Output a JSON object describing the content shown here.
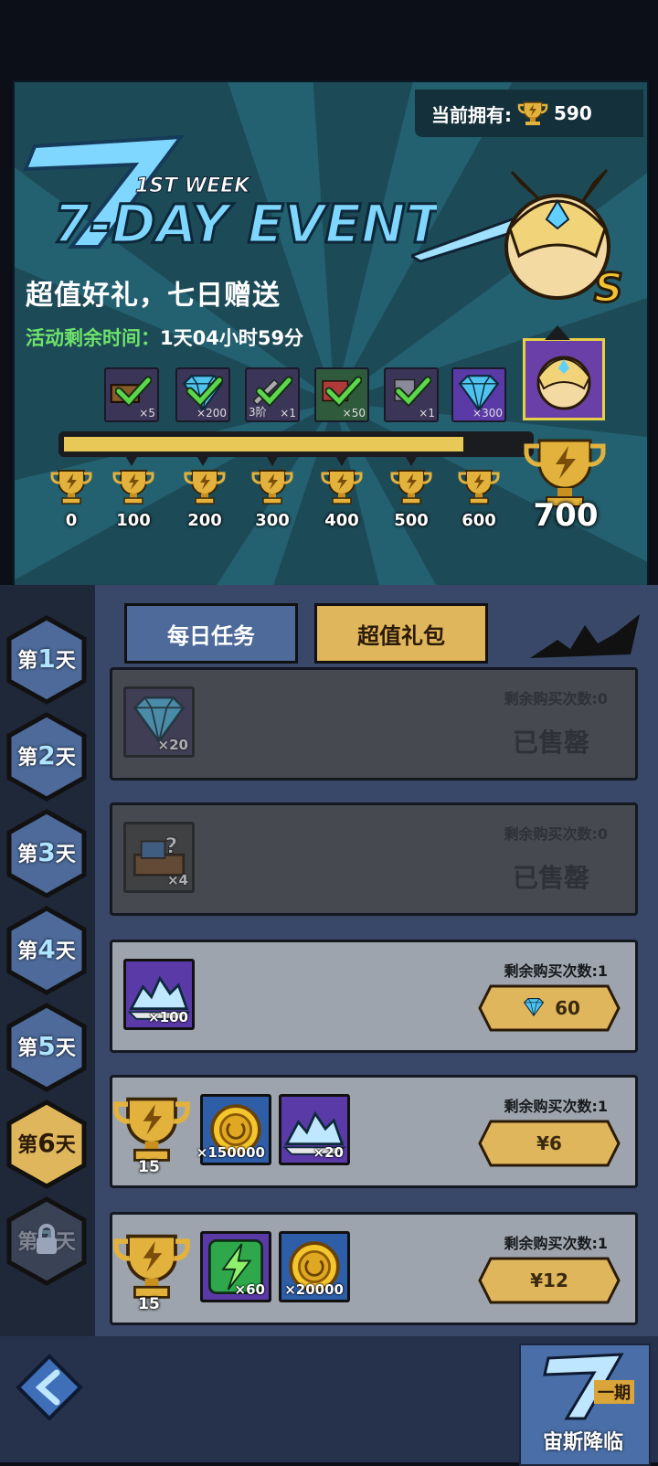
{
  "header": {
    "owned_label": "当前拥有:",
    "owned_value": "590",
    "event_week": "1ST WEEK",
    "event_name": "7-DAY EVENT",
    "subtitle": "超值好礼，七日赠送",
    "timer_label": "活动剩余时间：",
    "timer_value": "1天04小时59分",
    "hero_rank": "S"
  },
  "rewards": [
    {
      "qty": "×5",
      "claimed": true,
      "kind": "chest"
    },
    {
      "qty": "×200",
      "claimed": true,
      "kind": "diamond"
    },
    {
      "qty": "×1",
      "prefix": "3阶",
      "claimed": true,
      "kind": "weapon"
    },
    {
      "qty": "×50",
      "claimed": true,
      "kind": "book"
    },
    {
      "qty": "×1",
      "claimed": true,
      "kind": "gear"
    },
    {
      "qty": "×300",
      "claimed": false,
      "kind": "diamond"
    }
  ],
  "milestones": [
    "0",
    "100",
    "200",
    "300",
    "400",
    "500",
    "600"
  ],
  "final_milestone": "700",
  "progress_fraction": 0.86,
  "days": [
    {
      "prefix": "第",
      "num": "1",
      "suffix": "天",
      "state": "normal"
    },
    {
      "prefix": "第",
      "num": "2",
      "suffix": "天",
      "state": "normal"
    },
    {
      "prefix": "第",
      "num": "3",
      "suffix": "天",
      "state": "normal"
    },
    {
      "prefix": "第",
      "num": "4",
      "suffix": "天",
      "state": "normal"
    },
    {
      "prefix": "第",
      "num": "5",
      "suffix": "天",
      "state": "normal"
    },
    {
      "prefix": "第",
      "num": "6",
      "suffix": "天",
      "state": "active"
    },
    {
      "prefix": "第",
      "num": "7",
      "suffix": "天",
      "state": "locked"
    }
  ],
  "tabs": {
    "daily": "每日任务",
    "pack": "超值礼包"
  },
  "packs": [
    {
      "remain": "剩余购买次数:0",
      "status": "已售罄",
      "items": [
        {
          "kind": "diamond",
          "qty": "×20"
        }
      ]
    },
    {
      "remain": "剩余购买次数:0",
      "status": "已售罄",
      "items": [
        {
          "kind": "mystery-chest",
          "qty": "×4"
        }
      ]
    },
    {
      "remain": "剩余购买次数:1",
      "price": "60",
      "items": [
        {
          "kind": "diamond-pile",
          "qty": "×100"
        }
      ]
    },
    {
      "remain": "剩余购买次数:1",
      "price": "¥6",
      "cup": "15",
      "items": [
        {
          "kind": "gold-coin",
          "qty": "×150000"
        },
        {
          "kind": "diamond-pile",
          "qty": "×20"
        }
      ]
    },
    {
      "remain": "剩余购买次数:1",
      "price": "¥12",
      "cup": "15",
      "items": [
        {
          "kind": "energy",
          "qty": "×60"
        },
        {
          "kind": "gold-coin",
          "qty": "×20000"
        }
      ]
    }
  ],
  "bottom": {
    "zeus_label": "宙斯降临",
    "zeus_badge": "一期"
  },
  "colors": {
    "gold": "#e8c857",
    "banner": "#1d4a57",
    "panel": "#394869",
    "green_check": "#5cd64a"
  }
}
